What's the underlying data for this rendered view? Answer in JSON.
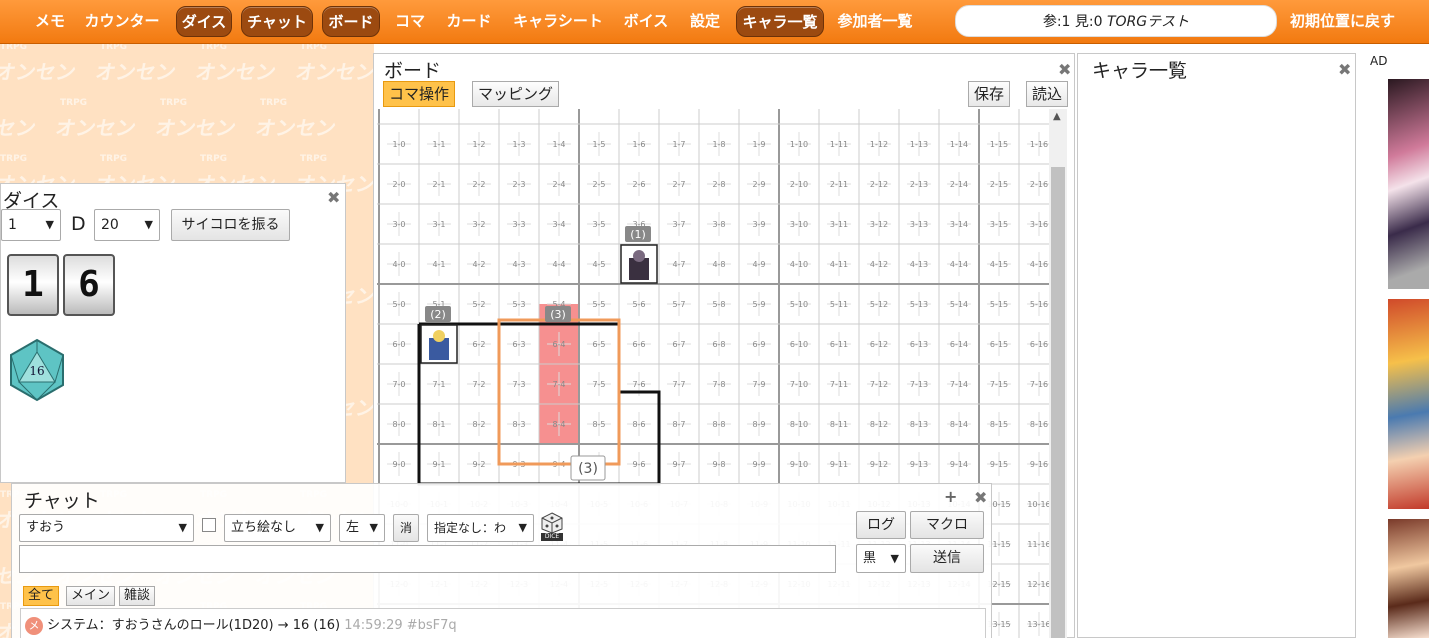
{
  "menu": {
    "items": [
      {
        "label": "メモ",
        "active": false
      },
      {
        "label": "カウンター",
        "active": false
      },
      {
        "label": "ダイス",
        "active": true
      },
      {
        "label": "チャット",
        "active": true
      },
      {
        "label": "ボード",
        "active": true
      },
      {
        "label": "コマ",
        "active": false
      },
      {
        "label": "カード",
        "active": false
      },
      {
        "label": "キャラシート",
        "active": false
      },
      {
        "label": "ボイス",
        "active": false
      },
      {
        "label": "設定",
        "active": false
      },
      {
        "label": "キャラ一覧",
        "active": true
      },
      {
        "label": "参加者一覧",
        "active": false
      }
    ],
    "room_counts": "参:1 見:0",
    "room_name": "TORGテスト",
    "reset_label": "初期位置に戻す"
  },
  "background": {
    "logo_small": "TRPG",
    "logo_word": "オンセン"
  },
  "dice": {
    "title": "ダイス",
    "count_value": "1",
    "d_label": "D",
    "sides_value": "20",
    "roll_label": "サイコロを振る",
    "result_digits": [
      "1",
      "6"
    ],
    "d20_value": "16"
  },
  "board": {
    "title": "ボード",
    "tabs": [
      {
        "label": "コマ操作",
        "active": true
      },
      {
        "label": "マッピング",
        "active": false
      }
    ],
    "save_label": "保存",
    "load_label": "読込",
    "pieces": [
      {
        "label": "(1)",
        "row": 4,
        "col": 6
      },
      {
        "label": "(2)",
        "row": 6,
        "col": 1
      },
      {
        "label": "(3)",
        "row": 6,
        "col": 4
      }
    ],
    "tooltip": "(3)"
  },
  "charlist": {
    "title": "キャラ一覧"
  },
  "ad": {
    "label": "AD"
  },
  "chat": {
    "title": "チャット",
    "plus": "+",
    "name_value": "すおう",
    "portrait_value": "立ち絵なし",
    "side_value": "左",
    "erase_label": "消",
    "target_value": "指定なし：わ",
    "dice_icon_label": "DICE",
    "log_label": "ログ",
    "macro_label": "マクロ",
    "color_value": "黒",
    "send_label": "送信",
    "tabs": [
      {
        "label": "全て",
        "active": true
      },
      {
        "label": "メイン",
        "active": false
      },
      {
        "label": "雑談",
        "active": false
      }
    ],
    "log": [
      {
        "badge": "メ",
        "text": "システム：すおうさんのロール(1D20) → 16 (16)",
        "time": "14:59:29 #bsF7q"
      }
    ]
  }
}
